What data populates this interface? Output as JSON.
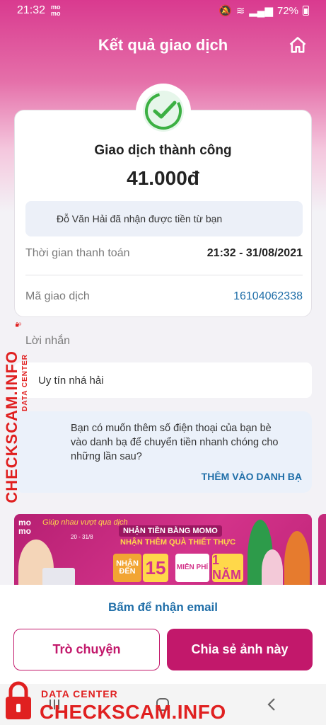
{
  "status_bar": {
    "time": "21:32",
    "app_mini_logo": "mo mo",
    "battery": "72%"
  },
  "header": {
    "title": "Kết quả giao dịch",
    "home_icon": "home-icon"
  },
  "result": {
    "status_text": "Giao dịch thành công",
    "amount": "41.000đ",
    "recipient_note": "Đỗ Văn Hải đã nhận được tiền từ bạn",
    "payment_time_label": "Thời gian thanh toán",
    "payment_time_value": "21:32 - 31/08/2021",
    "transaction_id_label": "Mã giao dịch",
    "transaction_id_value": "16104062338",
    "success_color": "#3cb043"
  },
  "message": {
    "label": "Lời nhắn",
    "text": "Uy tín nhá hải"
  },
  "contact_prompt": {
    "text": "Bạn có muốn thêm số điện thoại của bạn bè vào danh bạ để chuyển tiền nhanh chóng cho những lần sau?",
    "action": "THÊM VÀO DANH BẠ"
  },
  "banner": {
    "logo": "mo mo",
    "script": "Giúp nhau vượt qua dịch",
    "date": "20 - 31/8",
    "headline1": "NHẬN TIỀN BẰNG MOMO",
    "headline2": "NHẬN THÊM QUÀ THIẾT THỰC",
    "receive_up_to": "NHẬN ĐẾN",
    "number": "15",
    "free_label": "MIỄN PHÍ",
    "year": "1 NĂM"
  },
  "actions": {
    "email_link": "Bấm để nhận email",
    "chat_button": "Trò chuyện",
    "share_button": "Chia sẻ ảnh này"
  },
  "watermark": {
    "side_big": "CHECKSCAM.INFO",
    "side_small": "DATA CENTER",
    "bottom_small": "DATA CENTER",
    "bottom_big": "CHECKSCAM.INFO",
    "color": "#e02020"
  },
  "colors": {
    "brand": "#c2186b",
    "link": "#1f6ea8"
  }
}
